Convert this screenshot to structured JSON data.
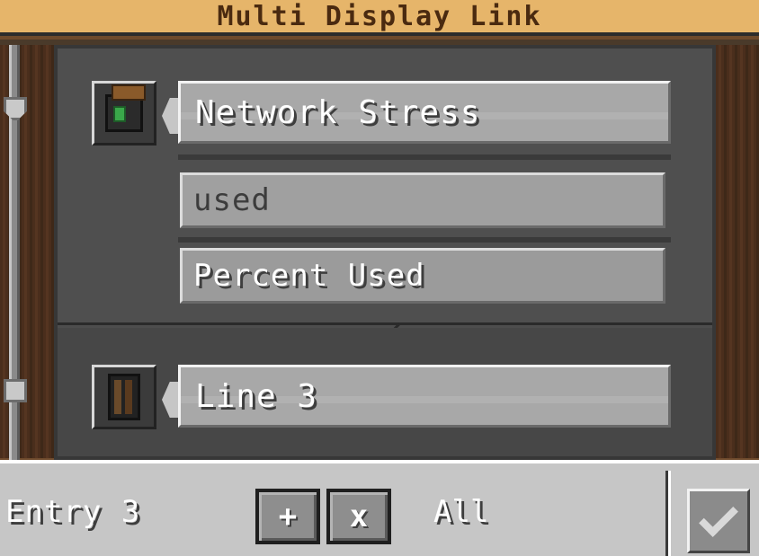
{
  "title": "Multi Display Link",
  "rows": [
    {
      "icon": "stressometer-icon",
      "label": "Network Stress"
    },
    {
      "icon": "display-link-icon",
      "label": "Line 3"
    }
  ],
  "options": {
    "input_value": "used",
    "select_value": "Percent Used"
  },
  "toolbar": {
    "entry_label": "Entry 3",
    "add_label": "+",
    "remove_label": "x",
    "all_label": "All"
  },
  "colors": {
    "title_bg": "#e6b56a",
    "panel": "#4d4d4d",
    "toolbar": "#c6c6c6"
  }
}
